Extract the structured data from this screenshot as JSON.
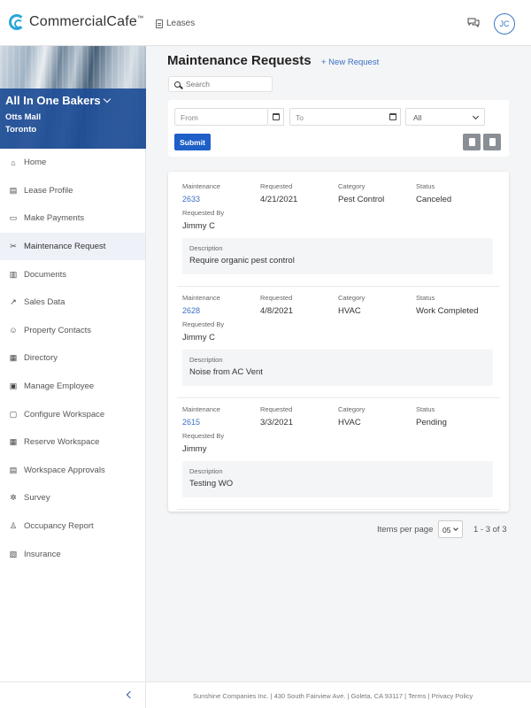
{
  "header": {
    "brand": "CommercialCafe",
    "brand_tm": "™",
    "leases_label": "Leases",
    "avatar_initials": "JC"
  },
  "sidebar": {
    "company": "All In One Bakers",
    "property": "Otts Mall",
    "city": "Toronto",
    "items": [
      {
        "label": "Home",
        "icon": "home-icon"
      },
      {
        "label": "Lease Profile",
        "icon": "document-icon"
      },
      {
        "label": "Make Payments",
        "icon": "payment-icon"
      },
      {
        "label": "Maintenance Request",
        "icon": "tools-icon"
      },
      {
        "label": "Documents",
        "icon": "documents-icon"
      },
      {
        "label": "Sales Data",
        "icon": "chart-icon"
      },
      {
        "label": "Property Contacts",
        "icon": "contacts-icon"
      },
      {
        "label": "Directory",
        "icon": "directory-icon"
      },
      {
        "label": "Manage Employee",
        "icon": "id-card-icon"
      },
      {
        "label": "Configure Workspace",
        "icon": "workspace-icon"
      },
      {
        "label": "Reserve Workspace",
        "icon": "calendar-icon"
      },
      {
        "label": "Workspace Approvals",
        "icon": "approval-icon"
      },
      {
        "label": "Survey",
        "icon": "survey-icon"
      },
      {
        "label": "Occupancy Report",
        "icon": "person-icon"
      },
      {
        "label": "Insurance",
        "icon": "insurance-icon"
      }
    ],
    "active_index": 3
  },
  "main": {
    "title": "Maintenance Requests",
    "new_request": "+ New Request",
    "search_placeholder": "Search",
    "filters": {
      "from_placeholder": "From",
      "to_placeholder": "To",
      "status_selected": "All",
      "submit_label": "Submit"
    },
    "labels": {
      "maintenance": "Maintenance",
      "requested": "Requested",
      "category": "Category",
      "status": "Status",
      "requested_by": "Requested By",
      "description": "Description"
    },
    "requests": [
      {
        "id": "2633",
        "requested": "4/21/2021",
        "category": "Pest Control",
        "status": "Canceled",
        "requested_by": "Jimmy C",
        "description": "Require organic pest control"
      },
      {
        "id": "2628",
        "requested": "4/8/2021",
        "category": "HVAC",
        "status": "Work Completed",
        "requested_by": "Jimmy C",
        "description": "Noise from AC Vent"
      },
      {
        "id": "2615",
        "requested": "3/3/2021",
        "category": "HVAC",
        "status": "Pending",
        "requested_by": "Jimmy",
        "description": "Testing WO"
      }
    ],
    "pagination": {
      "items_per_page_label": "Items per page",
      "per_page_value": "05",
      "range": "1 - 3 of 3"
    }
  },
  "footer": {
    "text": "Sunshine Companies Inc. | 430 South Fairview Ave. | Goleta, CA 93117 | Terms | Privacy Policy"
  },
  "colors": {
    "accent": "#1e5fc8",
    "link": "#3a6fc4",
    "brand_band": "#1e4d96",
    "logo": "#2aa6d8"
  }
}
